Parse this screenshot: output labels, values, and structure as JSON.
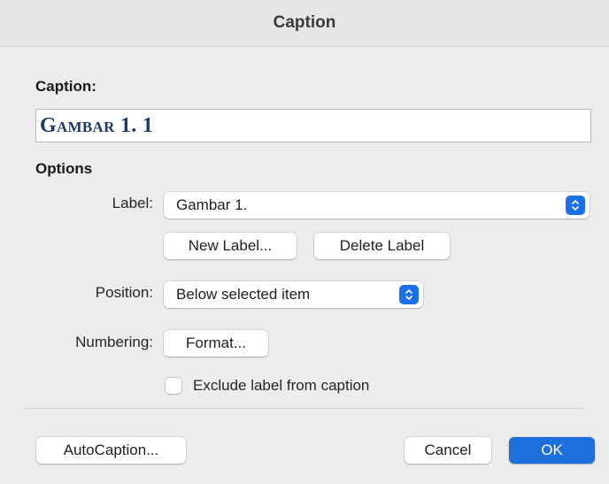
{
  "window": {
    "title": "Caption"
  },
  "caption_section": {
    "heading": "Caption:",
    "value": "Gambar 1. 1"
  },
  "options": {
    "heading": "Options",
    "label_row": {
      "label": "Label:",
      "selected": "Gambar 1."
    },
    "new_label_button": "New Label...",
    "delete_label_button": "Delete Label",
    "position_row": {
      "label": "Position:",
      "selected": "Below selected item"
    },
    "numbering_row": {
      "label": "Numbering:",
      "format_button": "Format..."
    },
    "exclude_checkbox": {
      "label": "Exclude label from caption",
      "checked": false
    }
  },
  "footer": {
    "autocaption_button": "AutoCaption...",
    "cancel_button": "Cancel",
    "ok_button": "OK"
  },
  "colors": {
    "accent": "#1d6fdc",
    "caption_text": "#1f3a68"
  },
  "icons": {
    "stepper": "up-down-chevron-icon"
  }
}
